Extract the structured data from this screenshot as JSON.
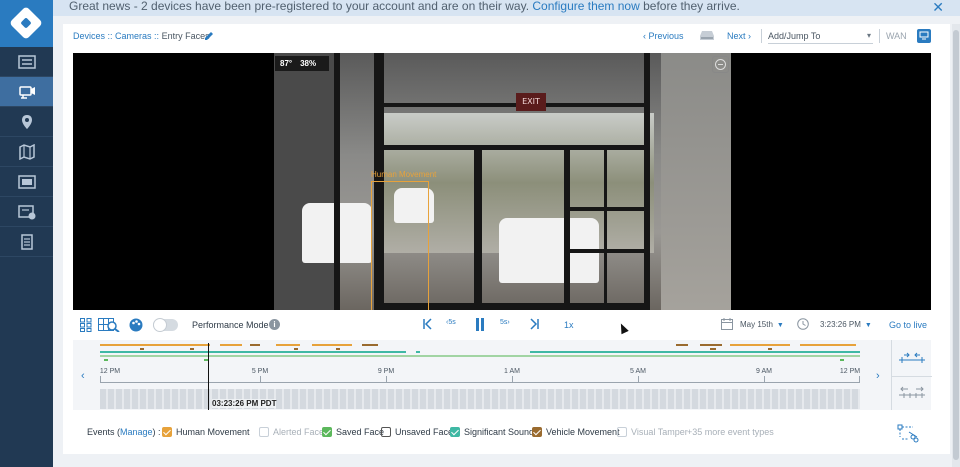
{
  "banner": {
    "message": "Great news - 2 devices have been pre-registered to your account and are on their way.",
    "link_text": "Configure them now",
    "tail": "before they arrive.",
    "close_icon": "close-icon"
  },
  "sidebar": {
    "logo_icon": "verkada-logo",
    "items": [
      {
        "icon": "devices-grid-icon",
        "active": false
      },
      {
        "icon": "camera-icon",
        "active": true
      },
      {
        "icon": "map-pin-icon",
        "active": false
      },
      {
        "icon": "map-icon",
        "active": false
      },
      {
        "icon": "video-wall-icon",
        "active": false
      },
      {
        "icon": "archive-icon",
        "active": false
      },
      {
        "icon": "document-icon",
        "active": false
      }
    ]
  },
  "header": {
    "breadcrumb_devices": "Devices",
    "breadcrumb_sep1": " :: ",
    "breadcrumb_cameras": "Cameras",
    "breadcrumb_sep2": " :: ",
    "breadcrumb_current": "Entry Faces",
    "previous_label": "Previous",
    "next_label": "Next",
    "jump_placeholder": "Add/Jump To",
    "wan_label": "WAN"
  },
  "video": {
    "temperature": "87°",
    "humidity": "38%",
    "exit_sign": "EXIT",
    "detection_label": "Human Movement",
    "accent": "#e7a23b"
  },
  "controls": {
    "performance_mode_label": "Performance Mode",
    "performance_mode_on": false,
    "speed": "1x",
    "date": "May 15th",
    "time": "3:23:26 PM",
    "go_live_label": "Go to live",
    "skip_back_label": "5s",
    "skip_forward_label": "5s"
  },
  "timeline": {
    "tick_labels": [
      "12 PM",
      "5 PM",
      "9 PM",
      "1 AM",
      "5 AM",
      "9 AM",
      "12 PM"
    ],
    "playhead_label": "03:23:26 PM PDT"
  },
  "events": {
    "label_prefix": "Events (",
    "manage_label": "Manage",
    "label_suffix": ") :",
    "types": [
      {
        "label": "Human Movement",
        "checked": true,
        "color": "#e7a23b",
        "enabled": true
      },
      {
        "label": "Alerted Face",
        "checked": false,
        "color": "#ffffff",
        "enabled": false
      },
      {
        "label": "Saved Face",
        "checked": true,
        "color": "#5cb85c",
        "enabled": true
      },
      {
        "label": "Unsaved Face",
        "checked": false,
        "color": "#ffffff",
        "enabled": true
      },
      {
        "label": "Significant Sound",
        "checked": true,
        "color": "#3fb8a4",
        "enabled": true
      },
      {
        "label": "Vehicle Movement",
        "checked": true,
        "color": "#9a6b2f",
        "enabled": true
      },
      {
        "label": "Visual Tamper",
        "checked": false,
        "color": "#ffffff",
        "enabled": false
      }
    ],
    "more_label": "+35 more event types"
  }
}
